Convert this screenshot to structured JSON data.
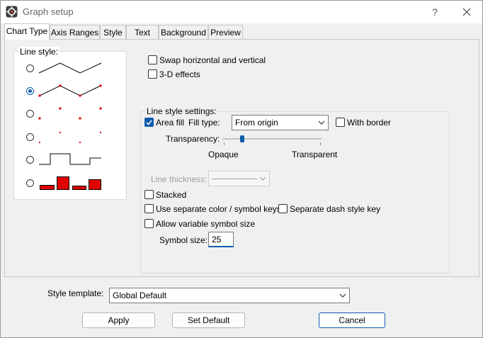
{
  "window": {
    "title": "Graph setup",
    "help_label": "?"
  },
  "tabs": [
    {
      "label": "Chart Type"
    },
    {
      "label": "Axis Ranges"
    },
    {
      "label": "Style"
    },
    {
      "label": "Text"
    },
    {
      "label": "Background"
    },
    {
      "label": "Preview"
    }
  ],
  "line_style": {
    "label": "Line style:",
    "selected_index": 1,
    "accent_color": "#e00000"
  },
  "options": {
    "swap_label": "Swap horizontal and vertical",
    "swap_checked": false,
    "three_d_label": "3-D effects",
    "three_d_checked": false
  },
  "settings": {
    "group_label": "Line style settings:",
    "area_fill_label": "Area fill",
    "area_fill_checked": true,
    "fill_type_label": "Fill type:",
    "fill_type_value": "From origin",
    "with_border_label": "With border",
    "with_border_checked": false,
    "transparency_label": "Transparency:",
    "transparency_min_label": "Opaque",
    "transparency_max_label": "Transparent",
    "transparency_value": 0.2,
    "line_thickness_label": "Line thickness:",
    "stacked_label": "Stacked",
    "stacked_checked": false,
    "separate_color_label": "Use separate color / symbol keys",
    "separate_color_checked": false,
    "separate_dash_label": "Separate dash style key",
    "separate_dash_checked": false,
    "variable_symbol_label": "Allow variable symbol size",
    "variable_symbol_checked": false,
    "symbol_size_label": "Symbol size:",
    "symbol_size_value": "25"
  },
  "footer": {
    "style_template_label": "Style template:",
    "style_template_value": "Global Default",
    "apply_label": "Apply",
    "set_default_label": "Set Default",
    "cancel_label": "Cancel"
  }
}
